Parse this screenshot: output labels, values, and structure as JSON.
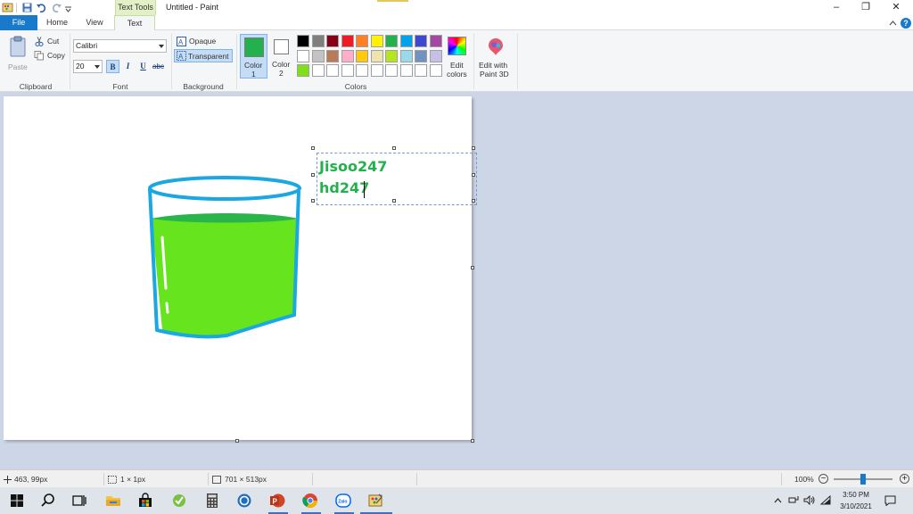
{
  "title_bar": {
    "text_tools_label": "Text Tools",
    "app_title": "Untitled - Paint",
    "minimize": "–",
    "maximize": "❐",
    "close": "✕"
  },
  "tabs": [
    "File",
    "Home",
    "View",
    "Text"
  ],
  "help_label": "?",
  "clipboard": {
    "paste_label": "Paste",
    "cut_label": "Cut",
    "copy_label": "Copy",
    "group_label": "Clipboard"
  },
  "font": {
    "family": "Calibri",
    "size": "20",
    "bold": "B",
    "italic": "I",
    "underline": "U",
    "strike": "abc",
    "group_label": "Font"
  },
  "background": {
    "opaque_label": "Opaque",
    "transparent_label": "Transparent",
    "group_label": "Background"
  },
  "colors": {
    "color1_label": "Color",
    "color1_num": "1",
    "color2_label": "Color",
    "color2_num": "2",
    "color1_value": "#22b14c",
    "color2_value": "#ffffff",
    "palette_row1": [
      "#000000",
      "#7f7f7f",
      "#880015",
      "#ed1c24",
      "#ff7f27",
      "#fff200",
      "#22b14c",
      "#00a2e8",
      "#3f48cc",
      "#a349a4"
    ],
    "palette_row2": [
      "#ffffff",
      "#c3c3c3",
      "#b97a57",
      "#ffaec9",
      "#ffc90e",
      "#efe4b0",
      "#b5e61d",
      "#99d9ea",
      "#7092be",
      "#c8bfe7"
    ],
    "palette_row3": [
      "#7fe01a",
      "#ffffff",
      "#ffffff",
      "#ffffff",
      "#ffffff",
      "#ffffff",
      "#ffffff",
      "#ffffff",
      "#ffffff",
      "#ffffff"
    ],
    "edit_colors_l1": "Edit",
    "edit_colors_l2": "colors",
    "group_label": "Colors"
  },
  "paint3d": {
    "line1": "Edit with",
    "line2": "Paint 3D"
  },
  "canvas_text": {
    "line1": "Jisoo247",
    "line2": "hd247"
  },
  "status": {
    "cursor_pos": "463, 99px",
    "selection_size": "1 × 1px",
    "canvas_size": "701 × 513px",
    "zoom": "100%"
  },
  "taskbar": {
    "time": "3:50 PM",
    "date": "3/10/2021"
  }
}
